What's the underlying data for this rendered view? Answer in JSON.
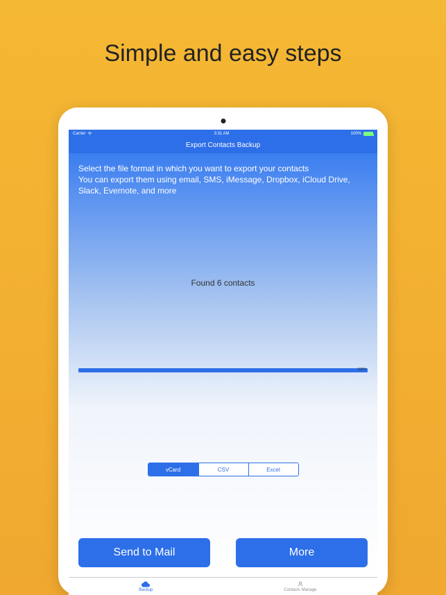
{
  "hero": {
    "title": "Simple and easy steps"
  },
  "status": {
    "carrier": "Carrier",
    "time": "3:31 AM",
    "battery": "100%"
  },
  "nav": {
    "title": "Export Contacts Backup"
  },
  "instructions": {
    "line1": "Select the file format in which you want to export your contacts",
    "line2": "You can export them using email, SMS, iMessage, Dropbox, iCloud Drive, Slack, Evernote, and more"
  },
  "contacts": {
    "found_text": "Found 6 contacts",
    "count": 6
  },
  "progress": {
    "percent_label": "100%"
  },
  "formats": {
    "options": [
      {
        "label": "vCard",
        "active": true
      },
      {
        "label": "CSV",
        "active": false
      },
      {
        "label": "Excel",
        "active": false
      }
    ]
  },
  "actions": {
    "send": "Send to Mail",
    "more": "More"
  },
  "tabs": {
    "items": [
      {
        "label": "Backup",
        "active": true
      },
      {
        "label": "Contacts Manage",
        "active": false
      }
    ]
  }
}
